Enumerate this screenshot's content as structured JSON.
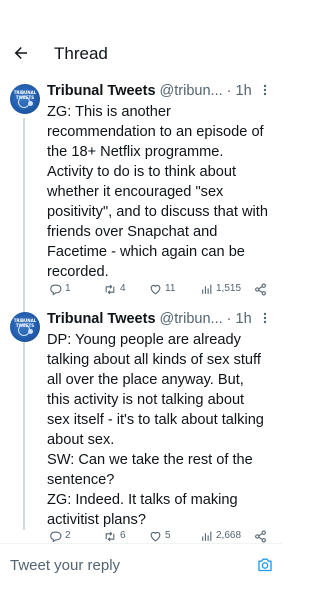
{
  "header": {
    "title": "Thread",
    "back_icon": "arrow-left-icon"
  },
  "tweets": [
    {
      "author_name": "Tribunal Tweets",
      "author_handle": "@tribun...",
      "separator": "·",
      "time": "1h",
      "avatar_text": "TRIBUNAL TWEETS",
      "text": "ZG: This is another recommendation to an episode of the 18+ Netflix programme. Activity to do is to think about whether it encouraged \"sex positivity\", and to discuss that with friends over Snapchat and Facetime - which again can be recorded.",
      "replies": "1",
      "retweets": "4",
      "likes": "11",
      "views": "1,515"
    },
    {
      "author_name": "Tribunal Tweets",
      "author_handle": "@tribun...",
      "separator": "·",
      "time": "1h",
      "avatar_text": "TRIBUNAL TWEETS",
      "text": "DP: Young people are already talking about all kinds of sex stuff all over the place anyway. But, this activity is not talking about sex itself - it's to talk about talking about sex.\nSW: Can we take the rest of the sentence?\nZG: Indeed. It talks of making activitist plans?",
      "replies": "2",
      "retweets": "6",
      "likes": "5",
      "views": "2,668"
    }
  ],
  "reply": {
    "placeholder": "Tweet your reply",
    "camera_icon": "camera-icon"
  },
  "colors": {
    "accent": "#1d9bf0",
    "secondary_text": "#536471",
    "thread_line": "#cfd9de"
  }
}
